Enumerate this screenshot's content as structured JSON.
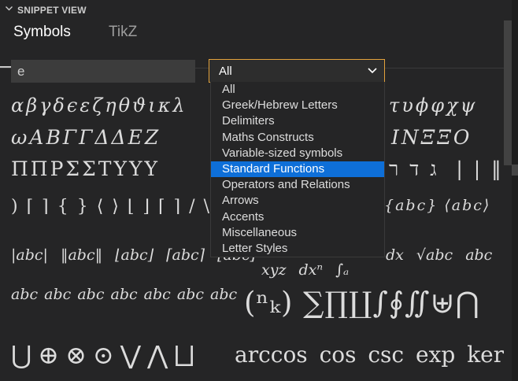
{
  "panel": {
    "title": "SNIPPET VIEW"
  },
  "tabs": [
    {
      "label": "Symbols"
    },
    {
      "label": "TikZ"
    }
  ],
  "search": {
    "value": "e"
  },
  "category_select": {
    "selected": "All",
    "highlighted": "Standard Functions",
    "options": [
      "All",
      "Greek/Hebrew Letters",
      "Delimiters",
      "Maths Constructs",
      "Variable-sized symbols",
      "Standard Functions",
      "Operators and Relations",
      "Arrows",
      "Accents",
      "Miscellaneous",
      "Letter Styles"
    ]
  },
  "symbols": {
    "row1": "αβγδϵεζηθϑικλ",
    "row1_right": "τυϕφχψ",
    "row2": "ωABΓΓΔΔEZ",
    "row2_right": "ΙΝΞΞΟ",
    "row3": "ΠΠΡΣΣΤΥΥΥ",
    "row3_right": "ג ד ר ‌ | | ‖ (",
    "row4": ") ⌈ ⌉ { } ⟨ ⟩ ⌊ ⌋ ⌈ ⌉ / \\ ⇑ ↑",
    "row4_right": "{abc}  ⟨abc⟩",
    "row5": "|abc|  ‖abc‖  ⌊abc⌋  ⌈abc⌉  ⌊abc⌋",
    "row5_right": "dx  √abc  abc",
    "row5b": "xyz  dxⁿ  ∫ₐ",
    "row6": "abc  abc  abc  abc  abc  abc  abc",
    "row6_right": "(ⁿₖ) ∑∏∐∫∮∬⊎⋂",
    "row7": "⋃⊕⊗⊙⋁⋀⨆",
    "row7_right": "arccos  cos  csc  exp  ker"
  },
  "icons": {
    "header_chevron": "chevron-down-icon",
    "select_chevron": "chevron-down-icon"
  },
  "colors": {
    "background": "#252526",
    "select_border": "#e2a23b",
    "highlight": "#0e6fd8"
  }
}
